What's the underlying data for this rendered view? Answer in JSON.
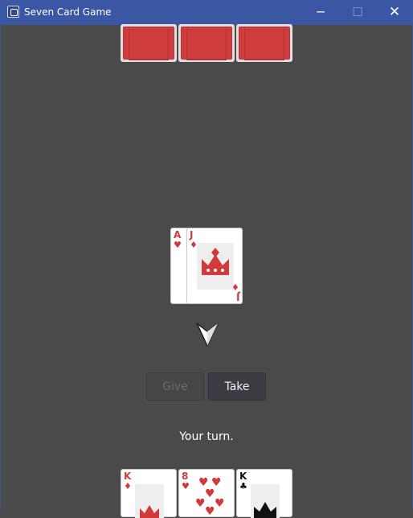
{
  "window": {
    "title": "Seven Card Game",
    "minimize_glyph": "─",
    "maximize_glyph": "☐",
    "close_glyph": "✕",
    "app_icon": "game-controller-icon"
  },
  "opponent_hand": {
    "count_visible": 3,
    "card_back_color": "#cf3c3e"
  },
  "pile": {
    "under_card": {
      "rank": "A",
      "suit": "♥"
    },
    "top_card": {
      "rank": "J",
      "suit": "♦",
      "bottom_rank": "J",
      "bottom_suit": "♦"
    }
  },
  "pointer": "arrow-down-icon",
  "actions": {
    "give_label": "Give",
    "take_label": "Take"
  },
  "status": {
    "message": "Your turn."
  },
  "player_hand": [
    {
      "rank": "K",
      "suit": "♦"
    },
    {
      "rank": "8",
      "suit": "♥"
    },
    {
      "rank": "K",
      "suit": "♣"
    }
  ],
  "colors": {
    "red_suit": "#d23a3a",
    "black_suit": "#111111",
    "table": "#4a4a4a",
    "titlebar": "#3b56a3"
  }
}
